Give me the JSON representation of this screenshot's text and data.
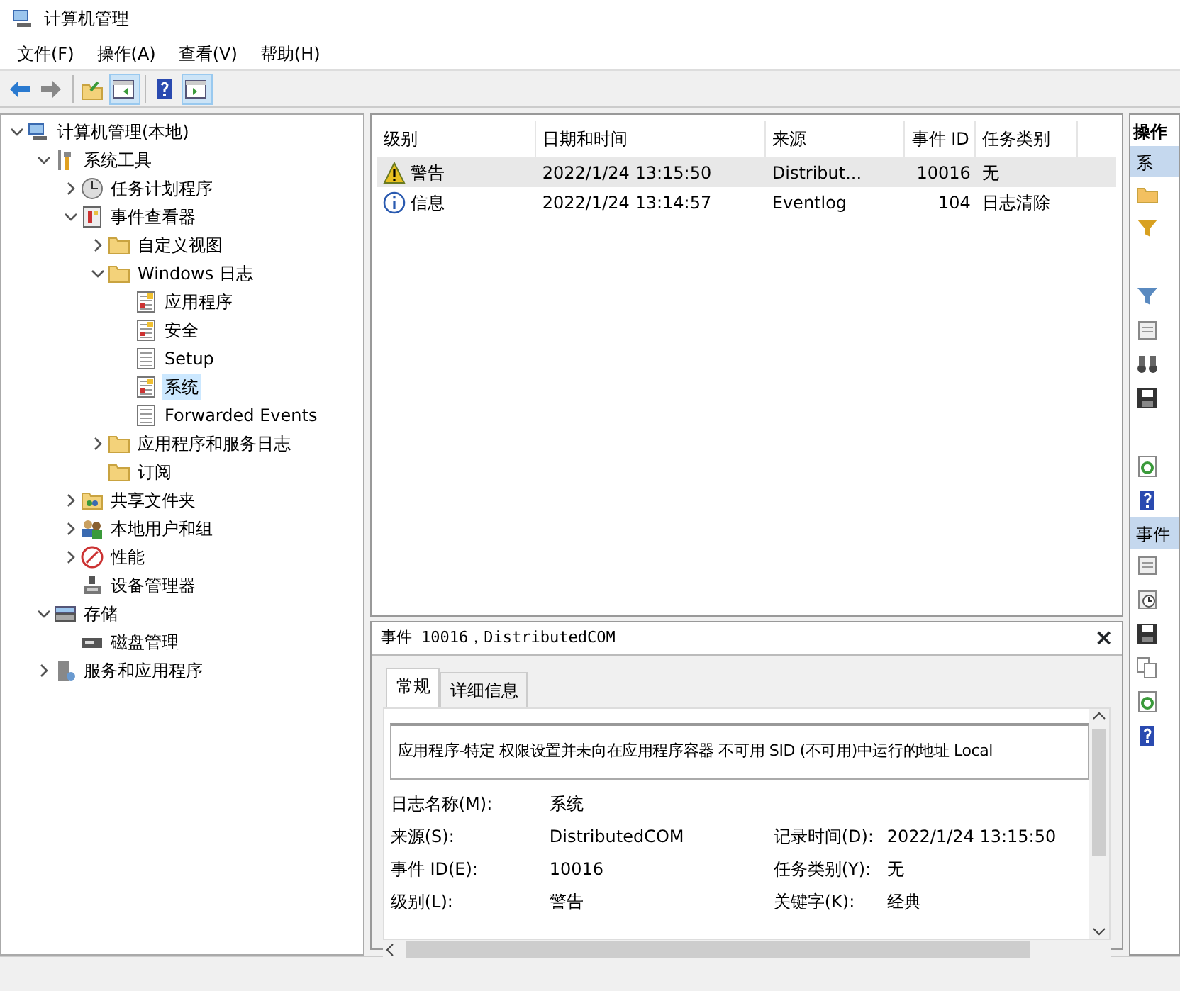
{
  "window": {
    "title": "计算机管理"
  },
  "menu": [
    {
      "label": "文件(F)"
    },
    {
      "label": "操作(A)"
    },
    {
      "label": "查看(V)"
    },
    {
      "label": "帮助(H)"
    }
  ],
  "toolbar": [
    {
      "kind": "back"
    },
    {
      "kind": "forward"
    },
    {
      "kind": "sep"
    },
    {
      "kind": "up"
    },
    {
      "kind": "pane-left",
      "selected": true
    },
    {
      "kind": "sep"
    },
    {
      "kind": "help"
    },
    {
      "kind": "pane-right",
      "selected": true
    }
  ],
  "tree": [
    {
      "label": "计算机管理(本地)",
      "kind": "computer",
      "expanded": true,
      "selected": false,
      "children": [
        {
          "label": "系统工具",
          "kind": "tools",
          "expanded": true,
          "selected": false,
          "children": [
            {
              "label": "任务计划程序",
              "kind": "clock",
              "expanded": false,
              "selected": false
            },
            {
              "label": "事件查看器",
              "kind": "viewer",
              "expanded": true,
              "selected": false,
              "children": [
                {
                  "label": "自定义视图",
                  "kind": "folder",
                  "expanded": false,
                  "selected": false
                },
                {
                  "label": "Windows 日志",
                  "kind": "folder",
                  "expanded": true,
                  "selected": false,
                  "children": [
                    {
                      "label": "应用程序",
                      "kind": "log",
                      "selected": false
                    },
                    {
                      "label": "安全",
                      "kind": "log",
                      "selected": false
                    },
                    {
                      "label": "Setup",
                      "kind": "doc",
                      "selected": false
                    },
                    {
                      "label": "系统",
                      "kind": "log",
                      "selected": true
                    },
                    {
                      "label": "Forwarded Events",
                      "kind": "doc",
                      "selected": false
                    }
                  ]
                },
                {
                  "label": "应用程序和服务日志",
                  "kind": "folder",
                  "expanded": false,
                  "selected": false
                },
                {
                  "label": "订阅",
                  "kind": "folder",
                  "selected": false
                }
              ]
            },
            {
              "label": "共享文件夹",
              "kind": "share",
              "expanded": false,
              "selected": false
            },
            {
              "label": "本地用户和组",
              "kind": "users",
              "expanded": false,
              "selected": false
            },
            {
              "label": "性能",
              "kind": "perf",
              "expanded": false,
              "selected": false
            },
            {
              "label": "设备管理器",
              "kind": "device",
              "selected": false
            }
          ]
        },
        {
          "label": "存储",
          "kind": "storage",
          "expanded": true,
          "selected": false,
          "children": [
            {
              "label": "磁盘管理",
              "kind": "disk",
              "selected": false
            }
          ]
        },
        {
          "label": "服务和应用程序",
          "kind": "services",
          "expanded": false,
          "selected": false
        }
      ]
    }
  ],
  "events": {
    "columns": [
      "级别",
      "日期和时间",
      "来源",
      "事件 ID",
      "任务类别"
    ],
    "rows": [
      {
        "kind": "warning",
        "level_text": "警告",
        "datetime": "2022/1/24 13:15:50",
        "source": "Distribut...",
        "event_id": "10016",
        "category": "无",
        "selected": true
      },
      {
        "kind": "info",
        "level_text": "信息",
        "datetime": "2022/1/24 13:14:57",
        "source": "Eventlog",
        "event_id": "104",
        "category": "日志清除",
        "selected": false
      }
    ]
  },
  "detail": {
    "title": "事件 10016，DistributedCOM",
    "close": "×",
    "tabs": [
      {
        "label": "常规",
        "selected": true
      },
      {
        "label": "详细信息",
        "selected": false
      }
    ],
    "description": "应用程序-特定 权限设置并未向在应用程序容器 不可用 SID (不可用)中运行的地址 Local",
    "fields": [
      {
        "label": "日志名称(M):",
        "value": "系统"
      },
      {
        "label": "来源(S):",
        "value": "DistributedCOM",
        "label2": "记录时间(D):",
        "value2": "2022/1/24 13:15:50"
      },
      {
        "label": "事件 ID(E):",
        "value": "10016",
        "label2": "任务类别(Y):",
        "value2": "无"
      },
      {
        "label": "级别(L):",
        "value": "警告",
        "label2": "关键字(K):",
        "value2": "经典"
      }
    ]
  },
  "actions": {
    "title": "操作",
    "sections": [
      {
        "title": "系",
        "items": [
          {
            "kind": "open"
          },
          {
            "kind": "filter-star"
          },
          {
            "kind": "gap"
          },
          {
            "kind": "filter"
          },
          {
            "kind": "props"
          },
          {
            "kind": "find"
          },
          {
            "kind": "save"
          },
          {
            "kind": "gap"
          },
          {
            "kind": "refresh"
          },
          {
            "kind": "help"
          }
        ]
      },
      {
        "title": "事件",
        "items": [
          {
            "kind": "props"
          },
          {
            "kind": "task"
          },
          {
            "kind": "save"
          },
          {
            "kind": "copy"
          },
          {
            "kind": "refresh"
          },
          {
            "kind": "help"
          }
        ]
      }
    ]
  }
}
